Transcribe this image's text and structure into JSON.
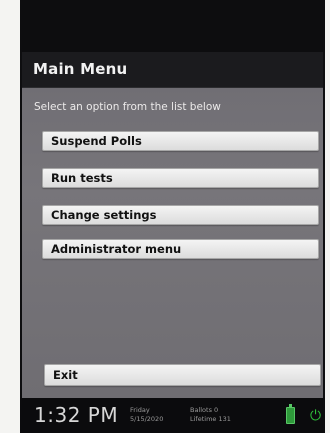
{
  "menu": {
    "title": "Main Menu",
    "instructions": "Select an option from the list below",
    "items": [
      {
        "label": "Suspend Polls"
      },
      {
        "label": "Run tests"
      },
      {
        "label": "Change settings"
      },
      {
        "label": "Administrator menu"
      }
    ],
    "exit_label": "Exit"
  },
  "status": {
    "time": "1:32 PM",
    "day": "Friday",
    "date": "5/15/2020",
    "ballots_label": "Ballots",
    "ballots_value": "0",
    "lifetime_label": "Lifetime",
    "lifetime_value": "131",
    "battery_icon": "battery-icon",
    "plug_icon": "power-plug-icon",
    "colors": {
      "title_bar": "#1b1b1e",
      "screen_bg": "#747277",
      "button": "#e8e8e8",
      "battery_green": "#2f9a3b"
    }
  }
}
